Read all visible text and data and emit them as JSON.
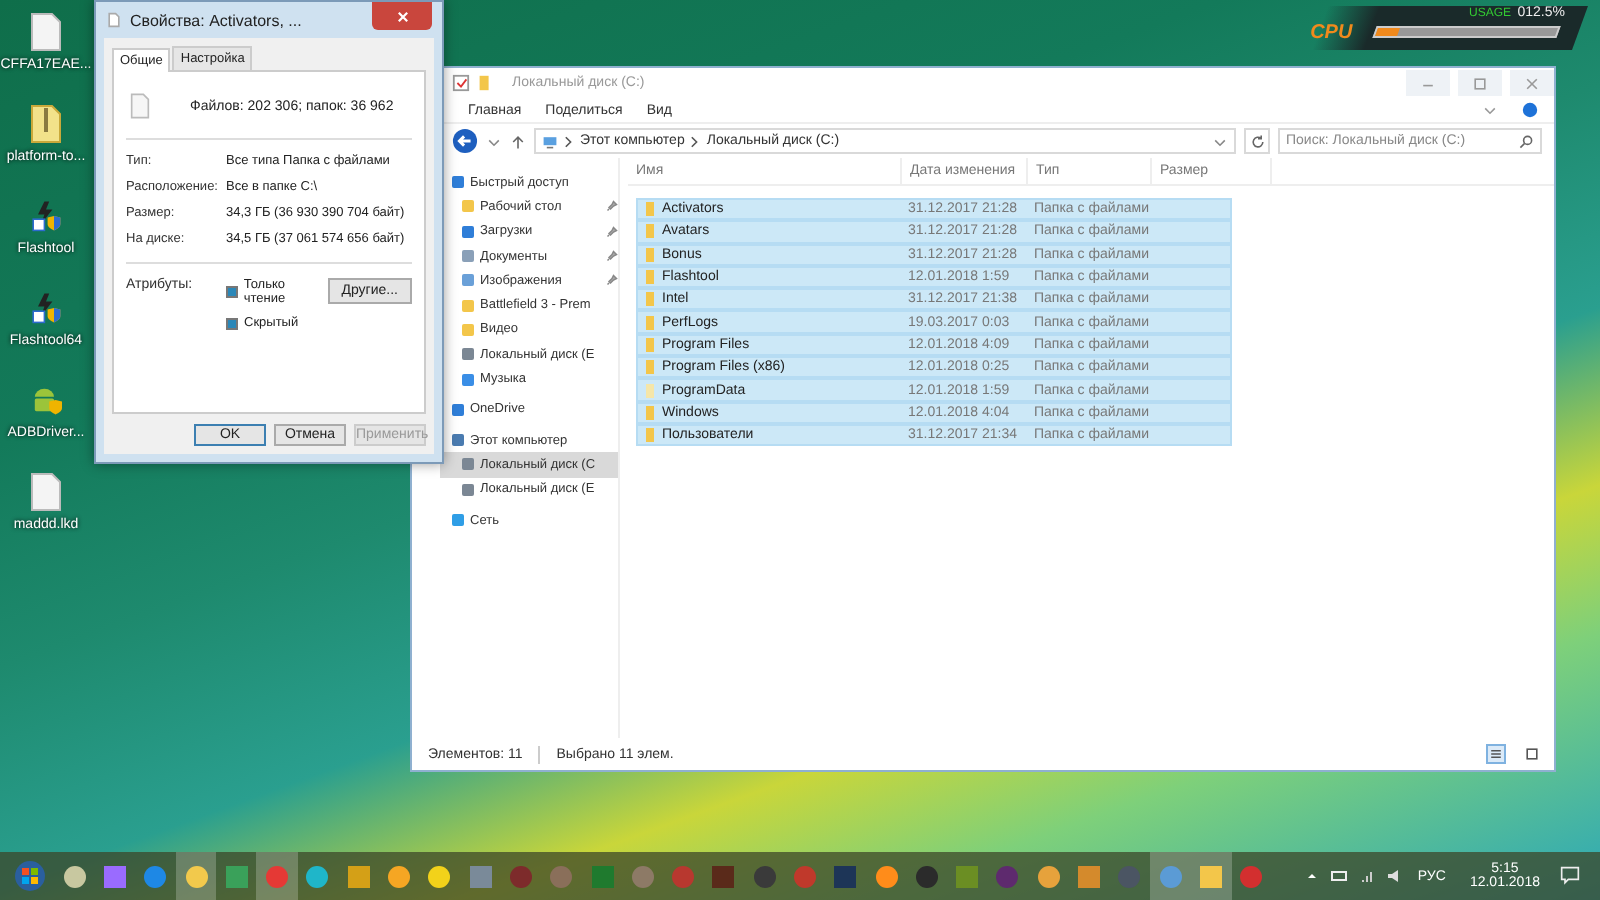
{
  "desktop_icons": [
    {
      "label": "CFFA17EAE...",
      "kind": "file"
    },
    {
      "label": "platform-to...",
      "kind": "archive"
    },
    {
      "label": "Flashtool",
      "kind": "shortcut"
    },
    {
      "label": "Flashtool64",
      "kind": "shortcut"
    },
    {
      "label": "ADBDriver...",
      "kind": "android"
    },
    {
      "label": "maddd.lkd",
      "kind": "file"
    }
  ],
  "cpu_widget": {
    "title": "CPU",
    "usage_label": "USAGE",
    "reading": "012.5%",
    "level": 0.125
  },
  "properties_dialog": {
    "title": "Свойства: Activators, ...",
    "tabs": [
      {
        "label": "Общие",
        "selected": true
      },
      {
        "label": "Настройка",
        "selected": false
      }
    ],
    "summary": "Файлов: 202 306; папок: 36 962",
    "fields": [
      {
        "label": "Тип:",
        "value": "Все типа Папка с файлами"
      },
      {
        "label": "Расположение:",
        "value": "Все в папке C:\\"
      },
      {
        "label": "Размер:",
        "value": "34,3 ГБ (36 930 390 704 байт)"
      },
      {
        "label": "На диске:",
        "value": "34,5 ГБ (37 061 574 656 байт)"
      }
    ],
    "attributes_label": "Атрибуты:",
    "attributes": [
      {
        "label": "Только чтение",
        "indeterminate": true
      },
      {
        "label": "Скрытый",
        "indeterminate": true
      }
    ],
    "other_button": "Другие...",
    "buttons": [
      {
        "label": "OK",
        "disabled": false,
        "default": true
      },
      {
        "label": "Отмена",
        "disabled": false,
        "default": false
      },
      {
        "label": "Применить",
        "disabled": true,
        "default": false
      }
    ]
  },
  "explorer": {
    "title": "Локальный диск (C:)",
    "ribbon_tabs": [
      {
        "label": "Главная"
      },
      {
        "label": "Поделиться"
      },
      {
        "label": "Вид"
      }
    ],
    "breadcrumb": [
      "Этот компьютер",
      "Локальный диск (C:)"
    ],
    "search": {
      "placeholder": "Поиск: Локальный диск (C:)"
    },
    "nav": [
      {
        "label": "Быстрый доступ",
        "kind": "star",
        "selected": false,
        "children": [
          {
            "label": "Рабочий стол",
            "kind": "folder",
            "pinned": true,
            "selected": false
          },
          {
            "label": "Загрузки",
            "kind": "download",
            "pinned": true,
            "selected": false
          },
          {
            "label": "Документы",
            "kind": "doc",
            "pinned": true,
            "selected": false
          },
          {
            "label": "Изображения",
            "kind": "image",
            "pinned": true,
            "selected": false
          },
          {
            "label": "Battlefield 3 - Prem",
            "kind": "folder",
            "pinned": false,
            "selected": false
          },
          {
            "label": "Видео",
            "kind": "folder",
            "pinned": false,
            "selected": false
          },
          {
            "label": "Локальный диск (E",
            "kind": "drive",
            "pinned": false,
            "selected": false
          },
          {
            "label": "Музыка",
            "kind": "music",
            "pinned": false,
            "selected": false
          }
        ]
      },
      {
        "label": "OneDrive",
        "kind": "cloud",
        "selected": false
      },
      {
        "label": "Этот компьютер",
        "kind": "pc",
        "selected": false,
        "children": [
          {
            "label": "Локальный диск (C",
            "kind": "drive",
            "pinned": false,
            "selected": true
          },
          {
            "label": "Локальный диск (E",
            "kind": "drive",
            "pinned": false,
            "selected": false
          }
        ]
      },
      {
        "label": "Сеть",
        "kind": "network",
        "selected": false
      }
    ],
    "table": {
      "columns": [
        "Имя",
        "Дата изменения",
        "Тип",
        "Размер"
      ],
      "rows": [
        {
          "name": "Activators",
          "date": "31.12.2017 21:28",
          "type": "Папка с файлами",
          "selected": true,
          "kind": "folder"
        },
        {
          "name": "Avatars",
          "date": "31.12.2017 21:28",
          "type": "Папка с файлами",
          "selected": true,
          "kind": "folder"
        },
        {
          "name": "Bonus",
          "date": "31.12.2017 21:28",
          "type": "Папка с файлами",
          "selected": true,
          "kind": "folder"
        },
        {
          "name": "Flashtool",
          "date": "12.01.2018 1:59",
          "type": "Папка с файлами",
          "selected": true,
          "kind": "folder"
        },
        {
          "name": "Intel",
          "date": "31.12.2017 21:38",
          "type": "Папка с файлами",
          "selected": true,
          "kind": "folder"
        },
        {
          "name": "PerfLogs",
          "date": "19.03.2017 0:03",
          "type": "Папка с файлами",
          "selected": true,
          "kind": "folder"
        },
        {
          "name": "Program Files",
          "date": "12.01.2018 4:09",
          "type": "Папка с файлами",
          "selected": true,
          "kind": "folder"
        },
        {
          "name": "Program Files (x86)",
          "date": "12.01.2018 0:25",
          "type": "Папка с файлами",
          "selected": true,
          "kind": "folder"
        },
        {
          "name": "ProgramData",
          "date": "12.01.2018 1:59",
          "type": "Папка с файлами",
          "selected": true,
          "kind": "hidden"
        },
        {
          "name": "Windows",
          "date": "12.01.2018 4:04",
          "type": "Папка с файлами",
          "selected": true,
          "kind": "folder"
        },
        {
          "name": "Пользователи",
          "date": "31.12.2017 21:34",
          "type": "Папка с файлами",
          "selected": true,
          "kind": "folder"
        }
      ]
    },
    "status_bar": {
      "count": "Элементов: 11",
      "selection": "Выбрано 11 элем."
    }
  },
  "taskbar": {
    "apps": [
      {
        "active": false
      },
      {
        "active": false
      },
      {
        "active": false
      },
      {
        "active": true
      },
      {
        "active": false
      },
      {
        "active": true
      },
      {
        "active": false
      },
      {
        "active": false
      },
      {
        "active": false
      },
      {
        "active": false
      },
      {
        "active": false
      },
      {
        "active": false
      },
      {
        "active": false
      },
      {
        "active": false
      },
      {
        "active": false
      },
      {
        "active": false
      },
      {
        "active": false
      },
      {
        "active": false
      },
      {
        "active": false
      },
      {
        "active": false
      },
      {
        "active": false
      },
      {
        "active": false
      },
      {
        "active": false
      },
      {
        "active": false
      },
      {
        "active": false
      },
      {
        "active": false
      },
      {
        "active": false
      },
      {
        "active": true
      },
      {
        "active": true
      },
      {
        "active": false
      }
    ],
    "language": "РУС",
    "time": "5:15",
    "date": "12.01.2018"
  }
}
